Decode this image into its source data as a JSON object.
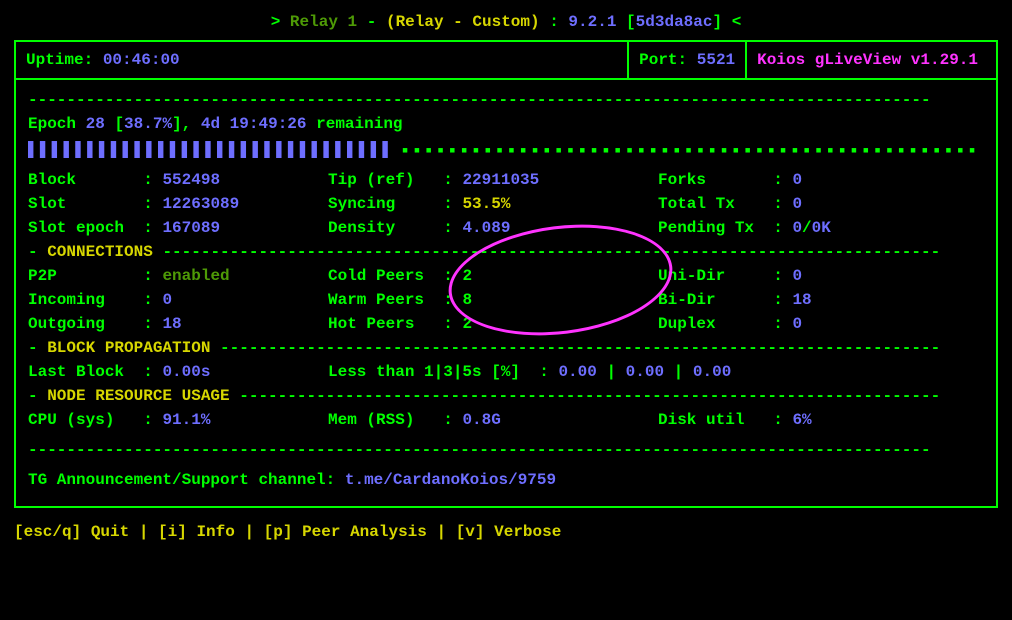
{
  "header": {
    "arrow_l": ">",
    "node_name": "Relay 1",
    "dash": "-",
    "role": "(Relay - Custom)",
    "colon": ":",
    "version": "9.2.1",
    "hash_open": "[",
    "hash": "5d3da8ac",
    "hash_close": "]",
    "arrow_r": "<"
  },
  "top": {
    "uptime_label": "Uptime:",
    "uptime_value": "00:46:00",
    "port_label": "Port:",
    "port_value": "5521",
    "app_title": "Koios gLiveView v1.29.1"
  },
  "epoch": {
    "label": "Epoch",
    "num": "28",
    "pct_open": "[",
    "pct": "38.7%",
    "pct_close": "],",
    "remaining": "4d 19:49:26",
    "remaining_label": "remaining",
    "progress_pct": 38.7
  },
  "stats": {
    "block_label": "Block       :",
    "block_value": "552498",
    "slot_label": "Slot        :",
    "slot_value": "12263089",
    "slotepoch_label": "Slot epoch  :",
    "slotepoch_value": "167089",
    "tipref_label": "Tip (ref)   :",
    "tipref_value": "22911035",
    "syncing_label": "Syncing     :",
    "syncing_value": "53.5%",
    "density_label": "Density     :",
    "density_value": "4.089",
    "forks_label": "Forks       :",
    "forks_value": "0",
    "totaltx_label": "Total Tx    :",
    "totaltx_value": "0",
    "pendingtx_label": "Pending Tx  :",
    "pendingtx_value": "0",
    "pendingtx_slash": "/",
    "pendingtx_k": "0K"
  },
  "sections": {
    "connections": "CONNECTIONS",
    "blockprop": "BLOCK PROPAGATION",
    "resource": "NODE RESOURCE USAGE"
  },
  "conns": {
    "p2p_label": "P2P         :",
    "p2p_value": "enabled",
    "incoming_label": "Incoming    :",
    "incoming_value": "0",
    "outgoing_label": "Outgoing    :",
    "outgoing_value": "18",
    "cold_label": "Cold Peers  :",
    "cold_value": "2",
    "warm_label": "Warm Peers  :",
    "warm_value": "8",
    "hot_label": "Hot Peers   :",
    "hot_value": "2",
    "unidir_label": "Uni-Dir     :",
    "unidir_value": "0",
    "bidir_label": "Bi-Dir      :",
    "bidir_value": "18",
    "duplex_label": "Duplex      :",
    "duplex_value": "0"
  },
  "blockprop": {
    "lastblock_label": "Last Block  :",
    "lastblock_value": "0.00s",
    "lt_label": "Less than 1|3|5s [%]  :",
    "lt_v1": "0.00",
    "lt_v2": "0.00",
    "lt_v3": "0.00",
    "pipe": " | "
  },
  "resource": {
    "cpu_label": "CPU (sys)   :",
    "cpu_value": "91.1%",
    "mem_label": "Mem (RSS)   :",
    "mem_value": "0.8G",
    "disk_label": "Disk util   :",
    "disk_value": "6%"
  },
  "tg": {
    "label": "TG Announcement/Support channel:",
    "value": "t.me/CardanoKoios/9759"
  },
  "hotkeys": {
    "quit": "[esc/q] Quit",
    "info": "[i] Info",
    "peer": "[p] Peer Analysis",
    "verbose": "[v] Verbose",
    "sep": "  |  "
  },
  "dashes": "----------------------------------------------------------------------------------------------"
}
